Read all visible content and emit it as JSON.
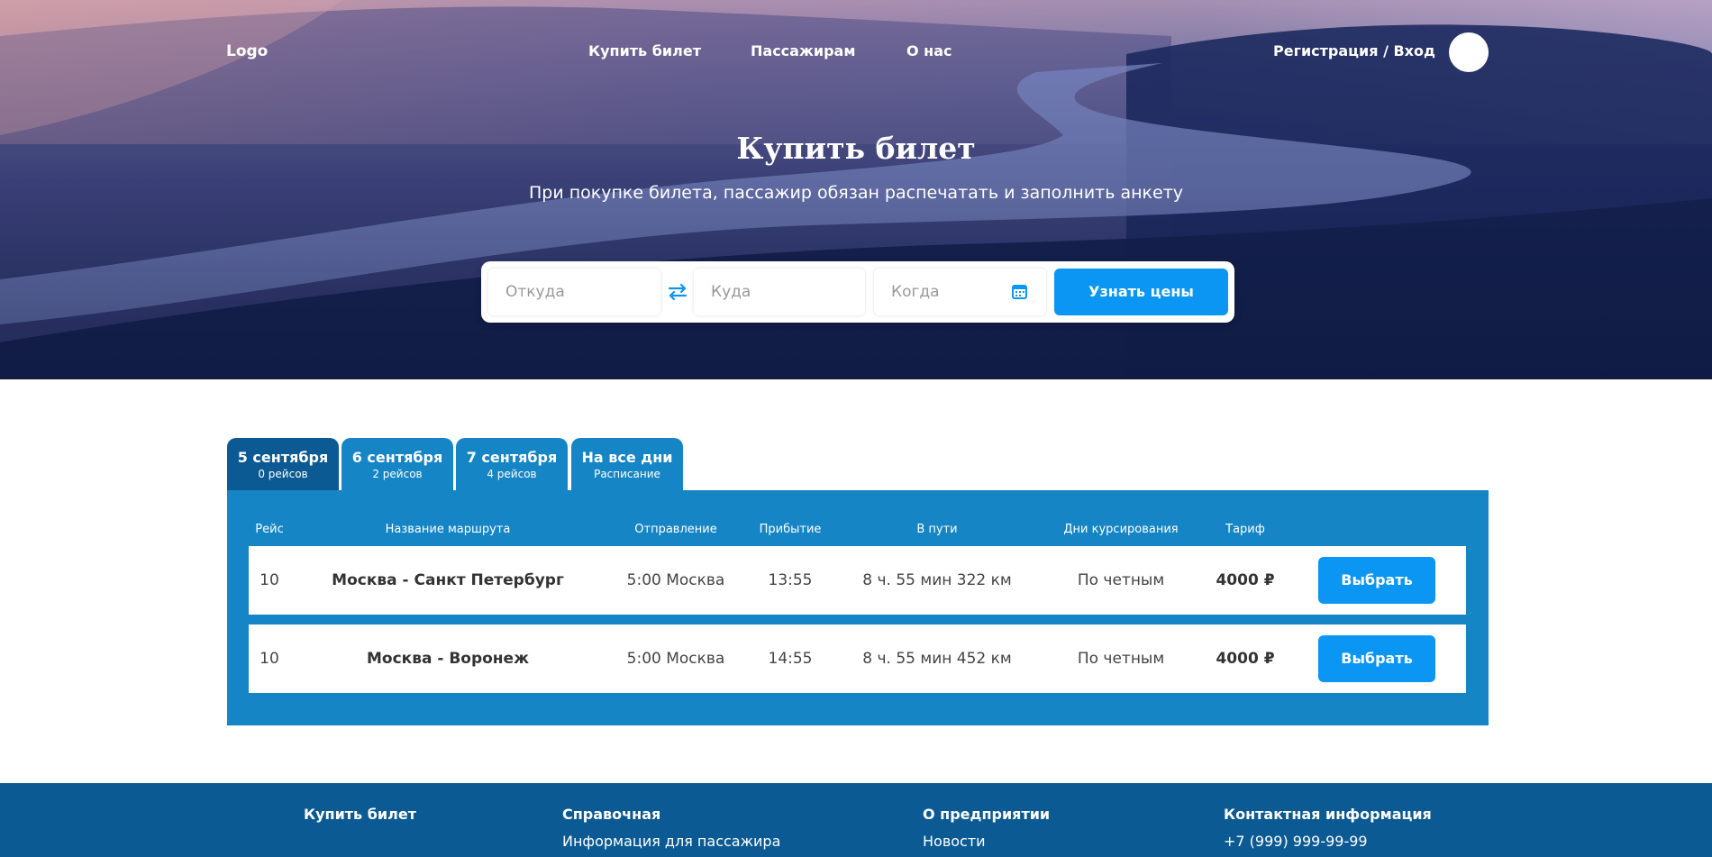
{
  "header": {
    "logo": "Logo",
    "nav": [
      "Купить билет",
      "Пассажирам",
      "О нас"
    ],
    "auth": "Регистрация / Вход"
  },
  "hero": {
    "title": "Купить билет",
    "subtitle": "При покупке билета, пассажир обязан распечатать и заполнить анкету"
  },
  "search": {
    "from_placeholder": "Откуда",
    "to_placeholder": "Куда",
    "date_placeholder": "Когда",
    "button": "Узнать цены"
  },
  "tabs": [
    {
      "day": "5 сентября",
      "sub": "0 рейсов",
      "active": true
    },
    {
      "day": "6 сентября",
      "sub": "2 рейсов",
      "active": false
    },
    {
      "day": "7 сентября",
      "sub": "4 рейсов",
      "active": false
    },
    {
      "day": "На все дни",
      "sub": "Расписание",
      "active": false
    }
  ],
  "table": {
    "headers": [
      "Рейс",
      "Название маршрута",
      "Отправление",
      "Прибытие",
      "В пути",
      "Дни курсирования",
      "Тариф"
    ],
    "rows": [
      {
        "flight": "10",
        "route": "Москва - Санкт Петербург",
        "depart": "5:00 Москва",
        "arrive": "13:55",
        "duration": "8 ч. 55 мин 322 км",
        "days": "По четным",
        "price": "4000 ₽",
        "button": "Выбрать"
      },
      {
        "flight": "10",
        "route": "Москва - Воронеж",
        "depart": "5:00 Москва",
        "arrive": "14:55",
        "duration": "8 ч. 55 мин 452 км",
        "days": "По четным",
        "price": "4000 ₽",
        "button": "Выбрать"
      }
    ]
  },
  "footer": {
    "columns": [
      {
        "title": "Купить билет",
        "link": ""
      },
      {
        "title": "Справочная",
        "link": "Информация для пассажира"
      },
      {
        "title": "О предприятии",
        "link": "Новости"
      },
      {
        "title": "Контактная информация",
        "link": "+7 (999) 999-99-99"
      }
    ]
  },
  "colors": {
    "accent": "#0a96f2",
    "panel": "#1685c6",
    "tab_active": "#0b5a93",
    "footer": "#0b5a93"
  }
}
